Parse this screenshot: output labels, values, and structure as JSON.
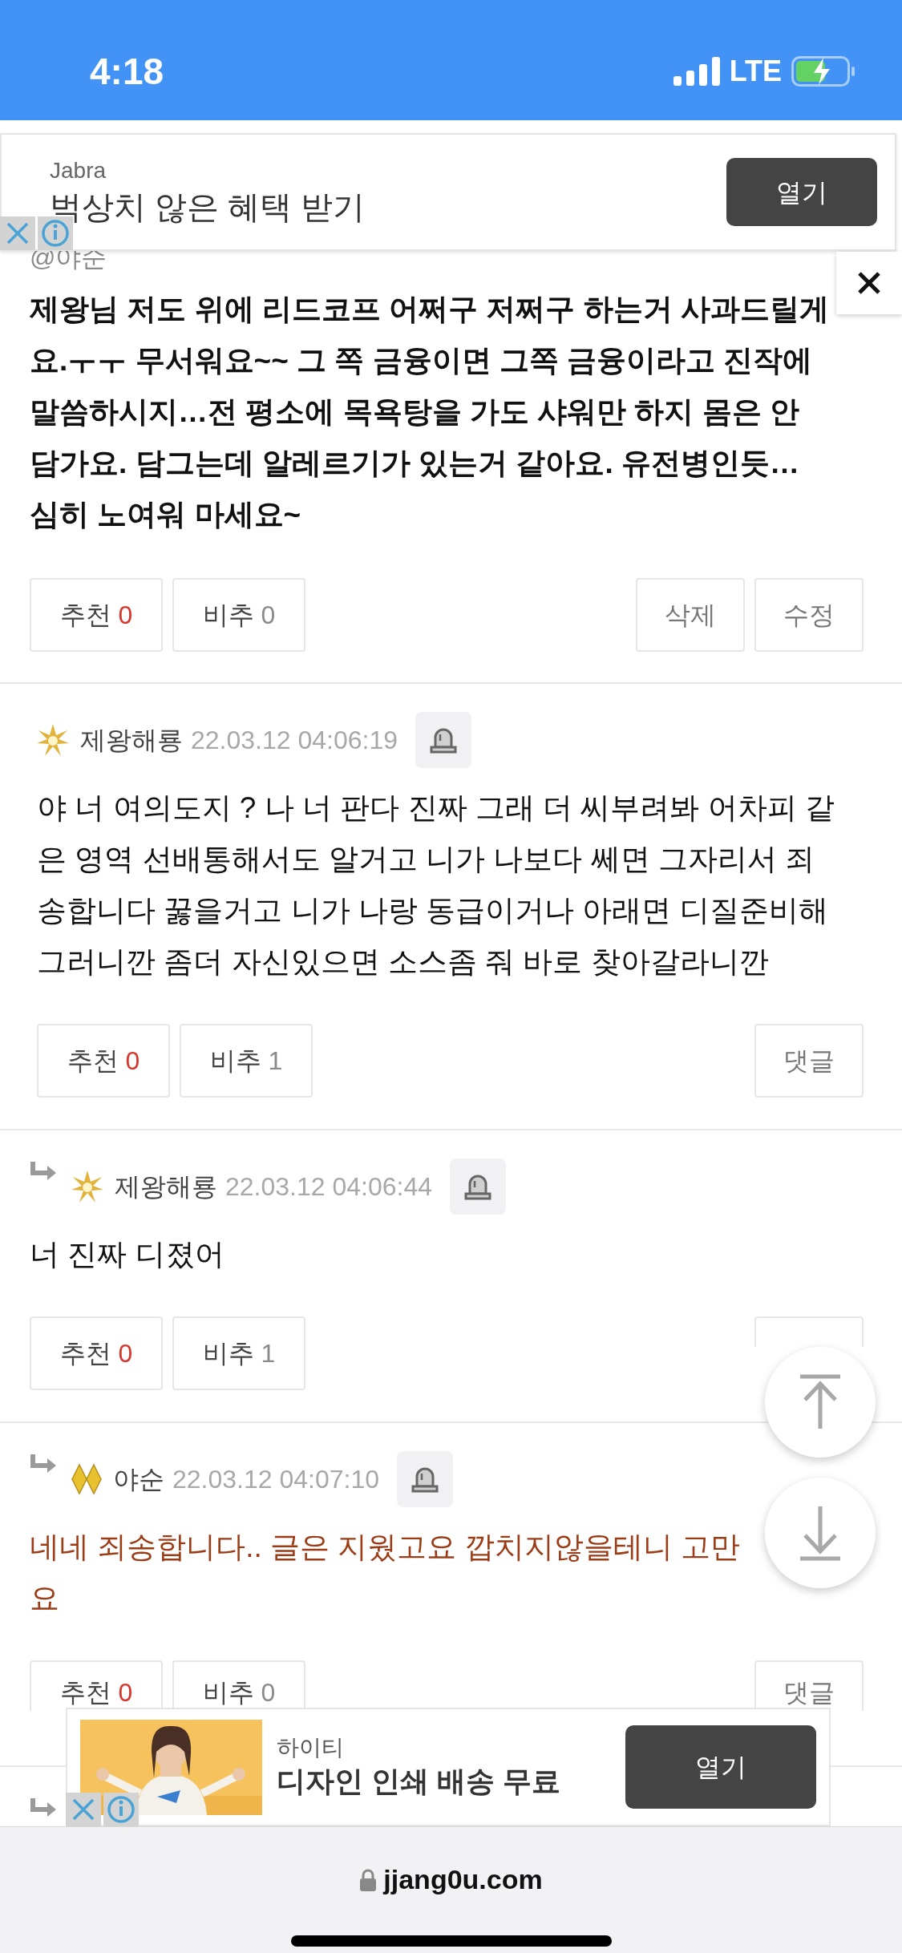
{
  "status_bar": {
    "time": "4:18",
    "network": "LTE"
  },
  "top_ad": {
    "advertiser": "Jabra",
    "headline": "벅상치 않은 혜택 받기",
    "button": "열기"
  },
  "comments": [
    {
      "kind": "continued",
      "handle": "@야순",
      "body": {
        "kind": "bold",
        "lines": [
          "제왕님 저도 위에 리드코프 어쩌구 저쩌구 하는거 사과드릴게",
          "요.ㅜㅜ 무서워요~~ 그 쪽 금융이면 그쪽 금융이라고 진작에",
          "말씀하시지…전 평소에 목욕탕을 가도 샤워만 하지 몸은 안",
          "담가요. 담그는데 알레르기가 있는거 같아요. 유전병인듯…",
          "심히 노여워 마세요~"
        ]
      },
      "votes": [
        {
          "kind": "up",
          "label": "추천",
          "count": "0"
        },
        {
          "kind": "down",
          "label": "비추",
          "count": "0"
        }
      ],
      "actions": [
        "삭제",
        "수정"
      ]
    },
    {
      "kind": "comment",
      "reply": false,
      "badge": {
        "kind": "sparkle"
      },
      "author": "제왕해룡",
      "date": "22.03.12 04:06:19",
      "body": {
        "kind": "plain",
        "lines": [
          "야 너 여의도지 ? 나 너 판다 진짜 그래 더 씨부려봐 어차피 같",
          "은 영역 선배통해서도 알거고 니가 나보다 쎄면 그자리서 죄",
          "송합니다 꿇을거고 니가 나랑 동급이거나 아래면 디질준비해",
          "그러니깐 좀더 자신있으면 소스좀 줘 바로 찾아갈라니깐"
        ]
      },
      "votes": [
        {
          "kind": "up",
          "label": "추천",
          "count": "0"
        },
        {
          "kind": "down",
          "label": "비추",
          "count": "1"
        }
      ],
      "actions": [
        "댓글"
      ]
    },
    {
      "kind": "comment",
      "reply": true,
      "badge": {
        "kind": "sparkle"
      },
      "author": "제왕해룡",
      "date": "22.03.12 04:06:44",
      "body": {
        "kind": "plain",
        "lines": [
          "너 진짜 디졌어"
        ]
      },
      "votes": [
        {
          "kind": "up",
          "label": "추천",
          "count": "0"
        },
        {
          "kind": "down",
          "label": "비추",
          "count": "1"
        }
      ],
      "actions": [
        {
          "kind": "covered"
        }
      ]
    },
    {
      "kind": "comment",
      "reply": true,
      "badge": {
        "kind": "diamond"
      },
      "author": "야순",
      "date": "22.03.12 04:07:10",
      "body": {
        "kind": "highlighted",
        "lines": [
          "네네 죄송합니다.. 글은 지웠고요 깝치지않을테니 고만",
          "요"
        ]
      },
      "votes": [
        {
          "kind": "up",
          "label": "추천",
          "count": "0"
        },
        {
          "kind": "down",
          "label": "비추",
          "count": "0"
        }
      ],
      "actions": [
        "댓글"
      ]
    },
    {
      "kind": "stub",
      "reply": true
    }
  ],
  "bottom_ad": {
    "advertiser": "하이티",
    "headline": "디자인 인쇄 배송 무료",
    "button": "열기"
  },
  "browser": {
    "url": "jjang0u.com"
  }
}
